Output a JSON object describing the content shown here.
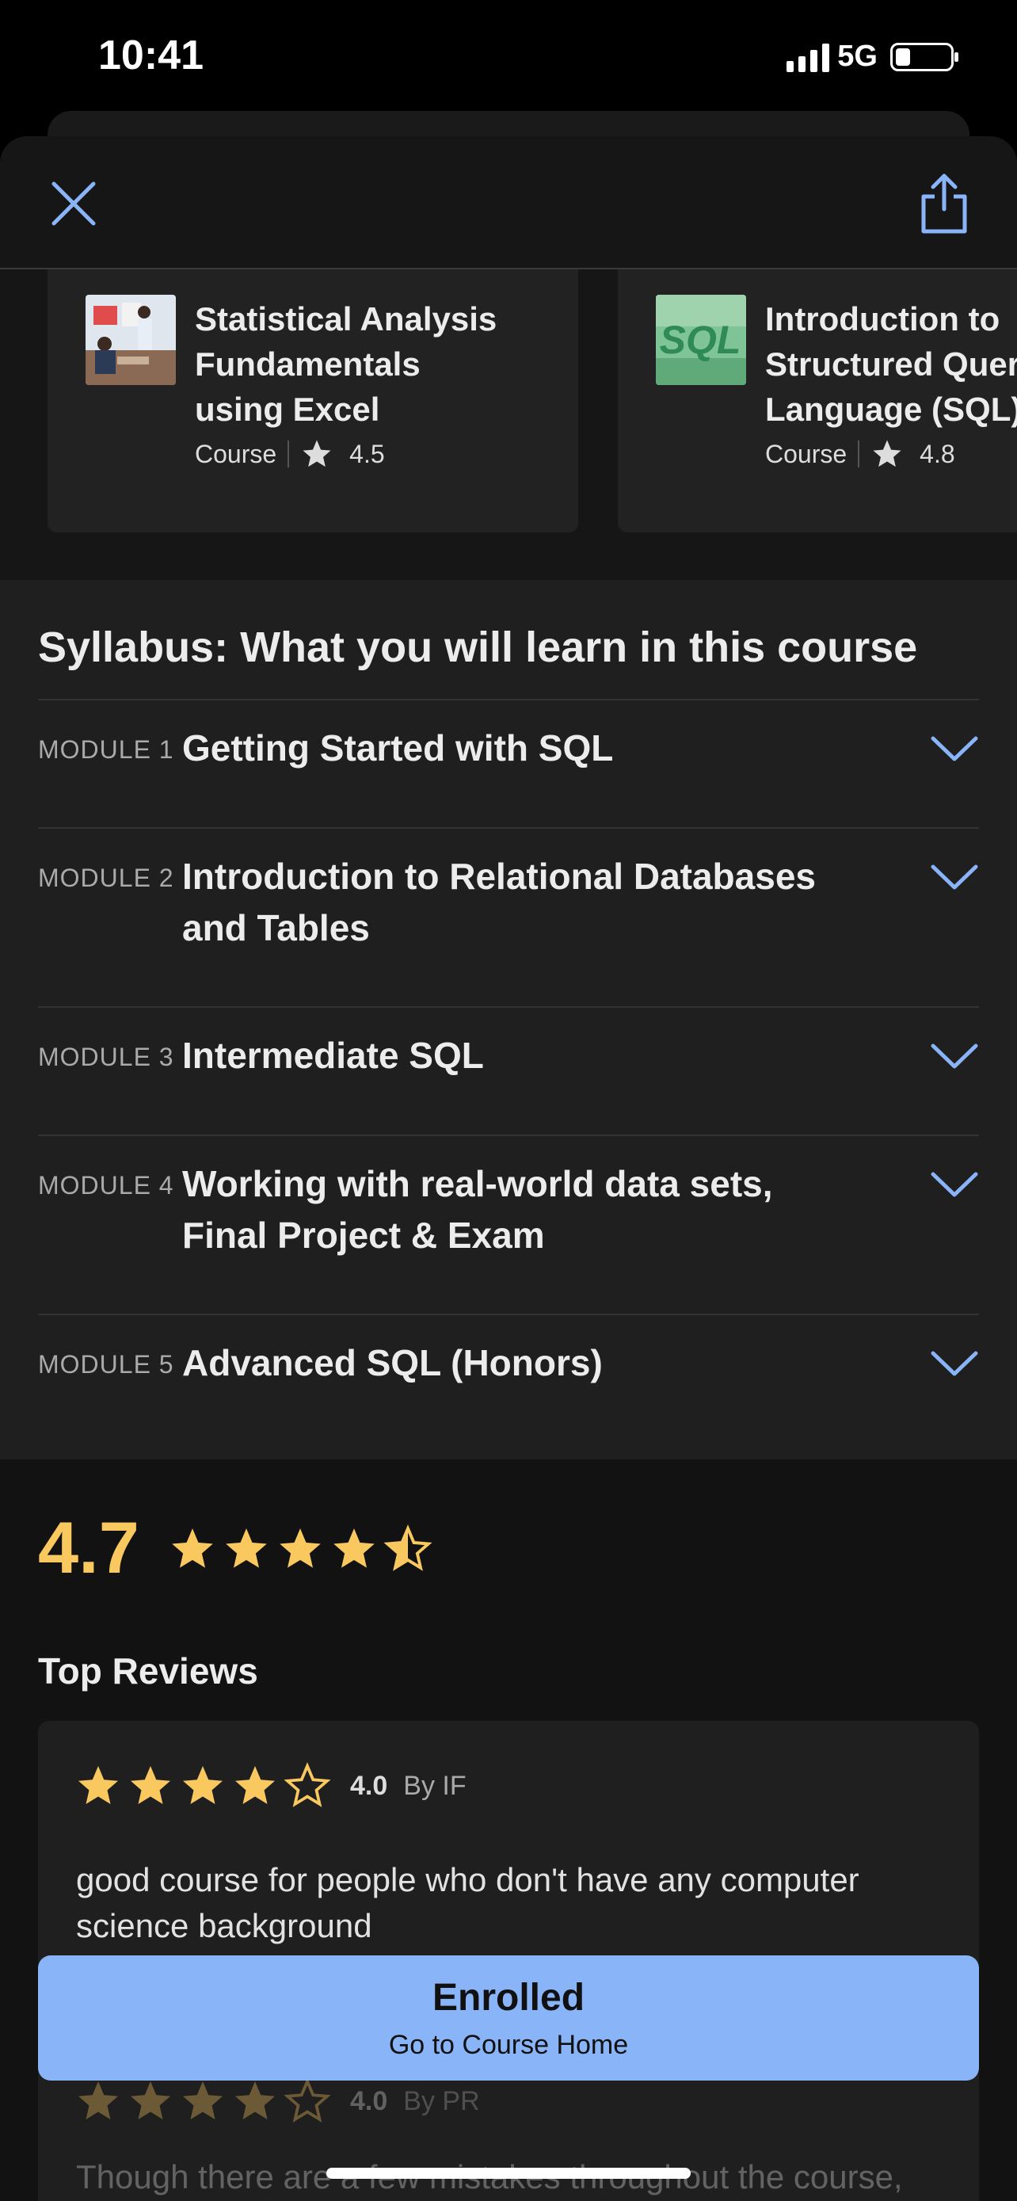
{
  "status_bar": {
    "time": "10:41",
    "network": "5G"
  },
  "related_courses": [
    {
      "title": "Statistical Analysis\nFundamentals\nusing Excel",
      "type": "Course",
      "rating": "4.5",
      "thumbnail_icon": "photo-thumbnail"
    },
    {
      "title": "Introduction to\nStructured Quer\nLanguage (SQL)",
      "type": "Course",
      "rating": "4.8",
      "thumbnail_icon": "sql-thumbnail",
      "thumbnail_text": "SQL"
    }
  ],
  "syllabus": {
    "title": "Syllabus: What you will learn in this course",
    "modules": [
      {
        "number": "MODULE 1",
        "title": "Getting Started with SQL"
      },
      {
        "number": "MODULE 2",
        "title": "Introduction to Relational Databases\nand Tables"
      },
      {
        "number": "MODULE 3",
        "title": "Intermediate SQL"
      },
      {
        "number": "MODULE 4",
        "title": "Working with real-world data sets,\nFinal Project & Exam"
      },
      {
        "number": "MODULE 5",
        "title": "Advanced SQL (Honors)"
      }
    ]
  },
  "ratings": {
    "average": "4.7",
    "top_reviews_label": "Top Reviews",
    "reviews": [
      {
        "score": "4.0",
        "by": "By IF",
        "stars": 4,
        "text": "good course for people who don't have any computer science background"
      },
      {
        "score": "4.0",
        "by": "By PR",
        "stars": 4,
        "text": "Though there are a few mistakes throughout the course,"
      }
    ]
  },
  "cta": {
    "title": "Enrolled",
    "subtitle": "Go to Course Home"
  },
  "colors": {
    "accent_blue": "#8ab4f8",
    "star_gold": "#f9c85f",
    "background": "#111111"
  }
}
